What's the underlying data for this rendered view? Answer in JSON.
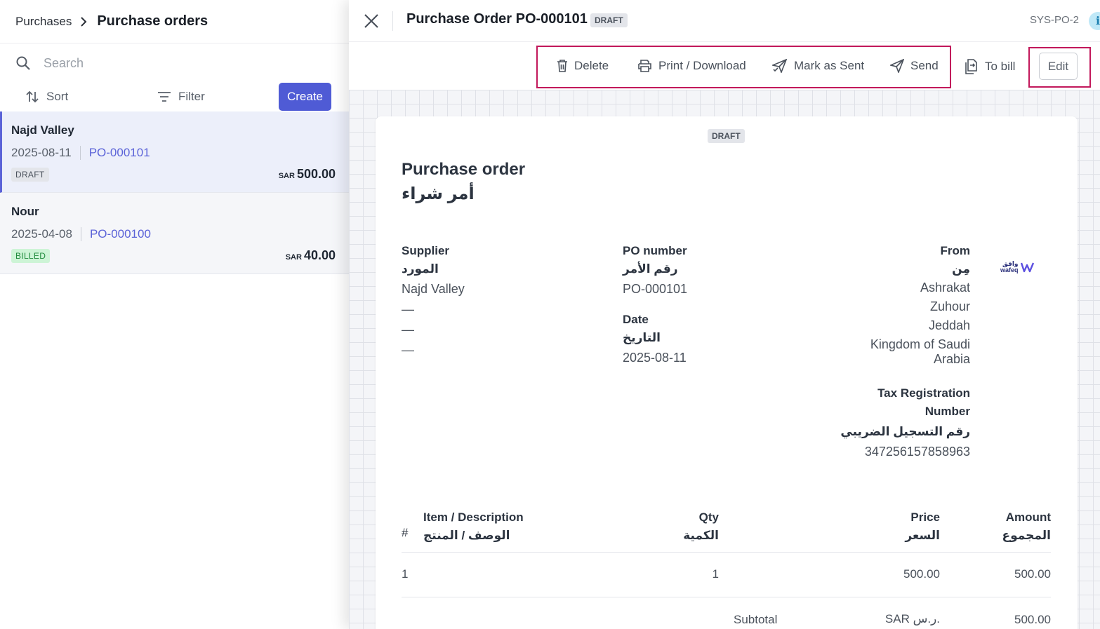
{
  "breadcrumb": {
    "root": "Purchases",
    "current": "Purchase orders"
  },
  "search": {
    "placeholder": "Search"
  },
  "toolbar": {
    "sort_label": "Sort",
    "filter_label": "Filter",
    "create_label": "Create"
  },
  "orders": [
    {
      "supplier": "Najd Valley",
      "date": "2025-08-11",
      "number": "PO-000101",
      "status": "DRAFT",
      "currency": "SAR",
      "amount": "500.00"
    },
    {
      "supplier": "Nour",
      "date": "2025-04-08",
      "number": "PO-000100",
      "status": "BILLED",
      "currency": "SAR",
      "amount": "40.00"
    }
  ],
  "detail": {
    "title": "Purchase Order PO-000101",
    "status": "DRAFT",
    "sys_id": "SYS-PO-2",
    "info_glyph": "i",
    "actions": {
      "delete": "Delete",
      "print": "Print / Download",
      "mark_sent": "Mark as Sent",
      "send": "Send",
      "to_bill": "To bill",
      "edit": "Edit"
    }
  },
  "document": {
    "status": "DRAFT",
    "heading_en": "Purchase order",
    "heading_ar": "أمر شراء",
    "supplier": {
      "label": "Supplier",
      "label_ar": "المورد",
      "name": "Najd Valley",
      "line2": "—",
      "line3": "—",
      "line4": "—"
    },
    "po_number": {
      "label": "PO number",
      "label_ar": "رقم الأمر",
      "value": "PO-000101"
    },
    "date": {
      "label": "Date",
      "label_ar": "التاريخ",
      "value": "2025-08-11"
    },
    "from": {
      "label": "From",
      "label_ar": "مِن",
      "line1": "Ashrakat",
      "line2": "Zuhour",
      "line3": "Jeddah",
      "line4": "Kingdom of Saudi Arabia"
    },
    "tax": {
      "label": "Tax Registration Number",
      "label_ar": "رقم التسجيل الضريبي",
      "value": "347256157858963"
    },
    "logo": {
      "text_ar": "وافق",
      "text_en": "wafeq"
    },
    "table": {
      "headers": {
        "index": "#",
        "item": "Item / Description",
        "item_ar": "الوصف / المنتج",
        "qty": "Qty",
        "qty_ar": "الكمية",
        "price": "Price",
        "price_ar": "السعر",
        "amount": "Amount",
        "amount_ar": "المجموع"
      },
      "rows": [
        {
          "index": "1",
          "qty": "1",
          "price": "500.00",
          "amount": "500.00"
        }
      ],
      "subtotal": {
        "label": "Subtotal",
        "currency": "SAR ر.س.",
        "value": "500.00"
      }
    }
  },
  "colors": {
    "accent": "#4f5bd5",
    "highlight": "#c2185b",
    "billed": "#1f8a3c"
  }
}
